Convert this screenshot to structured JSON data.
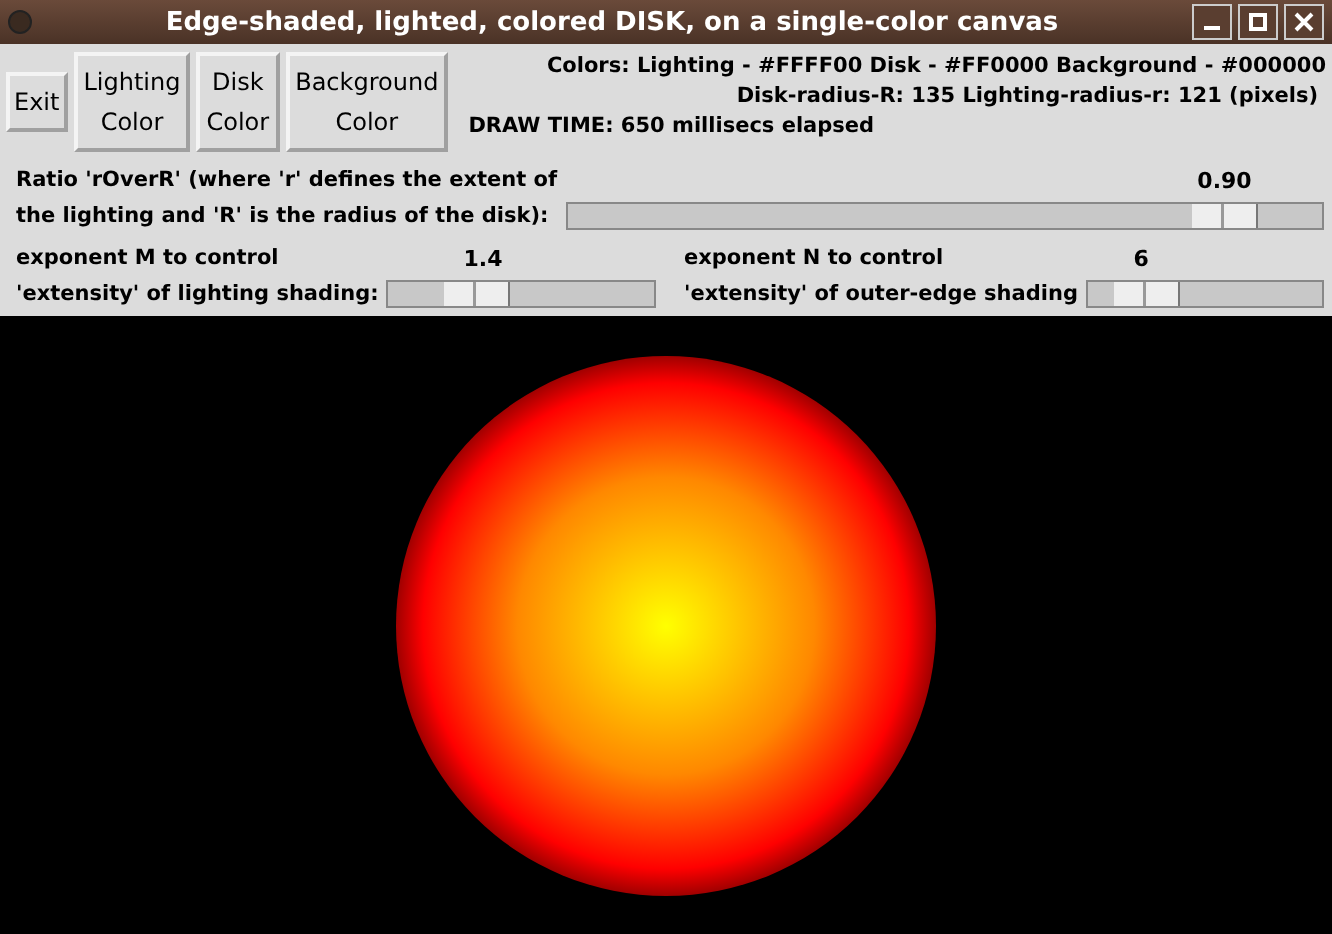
{
  "window": {
    "title": "Edge-shaded, lighted, colored DISK, on a single-color canvas"
  },
  "buttons": [
    {
      "lines": [
        "Exit"
      ]
    },
    {
      "lines": [
        "Lighting",
        "Color"
      ]
    },
    {
      "lines": [
        "Disk",
        "Color"
      ]
    },
    {
      "lines": [
        "Background",
        "Color"
      ]
    }
  ],
  "info": {
    "colors_line": "Colors:  Lighting - #FFFF00   Disk - #FF0000  Background - #000000",
    "radius_line": "Disk-radius-R: 135  Lighting-radius-r: 121  (pixels)",
    "draw_time": "DRAW TIME: 650 millisecs elapsed"
  },
  "ratio_slider": {
    "label_lines": [
      "Ratio 'rOverR' (where 'r' defines the extent of",
      "the lighting and 'R' is the radius of the disk):"
    ],
    "reading": "0.90",
    "level": 0.87
  },
  "sliders": [
    {
      "label_lines": [
        "exponent M to control",
        "'extensity' of lighting shading:"
      ],
      "reading": "1.4",
      "level": 0.33
    },
    {
      "label_lines": [
        "exponent N to control",
        "'extensity' of outer-edge shading"
      ],
      "reading": "6",
      "level": 0.25
    }
  ]
}
